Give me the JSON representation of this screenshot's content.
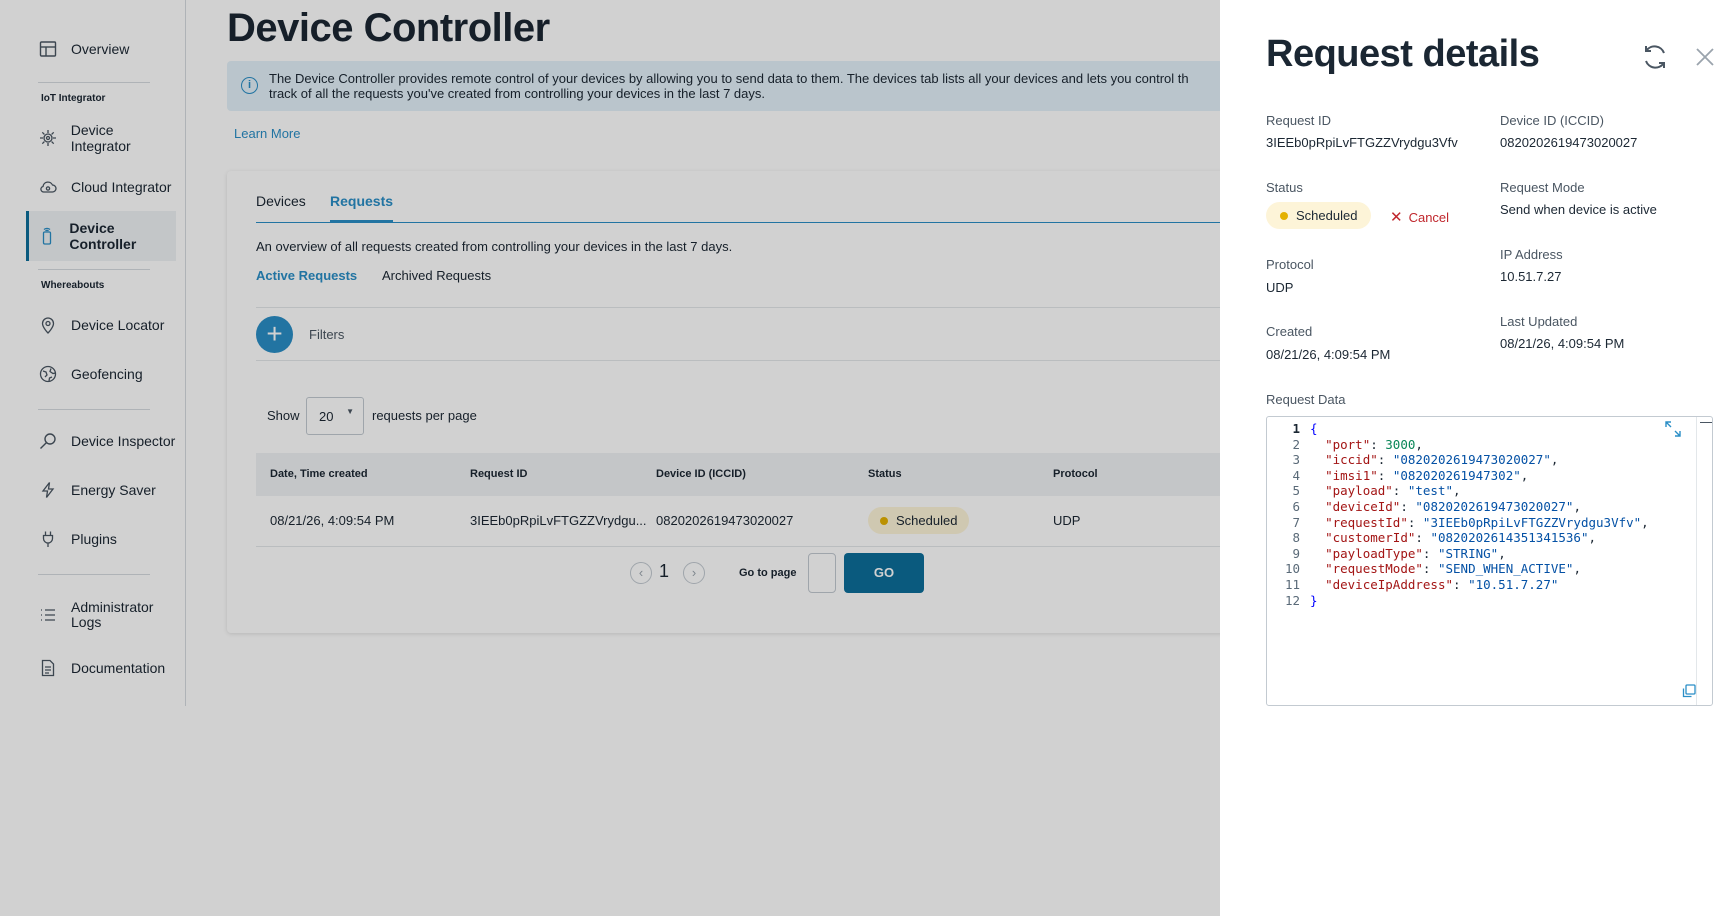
{
  "sidebar": {
    "items": [
      {
        "label": "Overview",
        "icon": "overview-icon"
      },
      {
        "label": "Device Integrator",
        "icon": "device-integrator-icon"
      },
      {
        "label": "Cloud Integrator",
        "icon": "cloud-integrator-icon"
      },
      {
        "label": "Device Controller",
        "icon": "device-controller-icon",
        "active": true
      },
      {
        "label": "Device Locator",
        "icon": "location-pin-icon"
      },
      {
        "label": "Geofencing",
        "icon": "geofencing-icon"
      },
      {
        "label": "Device Inspector",
        "icon": "inspector-icon"
      },
      {
        "label": "Energy Saver",
        "icon": "lightning-icon"
      },
      {
        "label": "Plugins",
        "icon": "plug-icon"
      },
      {
        "label": "Administrator Logs",
        "icon": "logs-icon"
      },
      {
        "label": "Documentation",
        "icon": "document-icon"
      }
    ],
    "sections": {
      "iot": "IoT Integrator",
      "whereabouts": "Whereabouts"
    }
  },
  "main": {
    "title": "Device Controller",
    "banner": "The Device Controller provides remote control of your devices by allowing you to send data to them. The devices tab lists all your devices and lets you control th track of all the requests you've created from controlling your devices in the last 7 days.",
    "banner_line1": "The Device Controller provides remote control of your devices by allowing you to send data to them. The devices tab lists all your devices and lets you control th",
    "banner_line2": "track of all the requests you've created from controlling your devices in the last 7 days.",
    "learn_more": "Learn More",
    "tabs": [
      {
        "label": "Devices"
      },
      {
        "label": "Requests",
        "active": true
      }
    ],
    "description": "An overview of all requests created from controlling your devices in the last 7 days.",
    "subtabs": [
      {
        "label": "Active Requests",
        "active": true
      },
      {
        "label": "Archived Requests"
      }
    ],
    "filters_label": "Filters",
    "show_label": "Show",
    "per_page_value": "20",
    "per_page_label": "requests per page",
    "table": {
      "columns": [
        "Date, Time created",
        "Request ID",
        "Device ID (ICCID)",
        "Status",
        "Protocol"
      ],
      "rows": [
        {
          "created": "08/21/26, 4:09:54 PM",
          "request_id": "3IEEb0pRpiLvFTGZZVrydgu...",
          "device_id": "0820202619473020027",
          "status": "Scheduled",
          "protocol": "UDP"
        }
      ]
    },
    "pagination": {
      "prev": "‹",
      "page": "1",
      "next": "›",
      "goto_label": "Go to page",
      "go_button": "GO"
    }
  },
  "drawer": {
    "title": "Request details",
    "fields": {
      "request_id_label": "Request ID",
      "request_id": "3IEEb0pRpiLvFTGZZVrydgu3Vfv",
      "device_id_label": "Device ID (ICCID)",
      "device_id": "0820202619473020027",
      "status_label": "Status",
      "status": "Scheduled",
      "cancel": "Cancel",
      "request_mode_label": "Request Mode",
      "request_mode": "Send when device is active",
      "ip_label": "IP Address",
      "ip": "10.51.7.27",
      "protocol_label": "Protocol",
      "protocol": "UDP",
      "created_label": "Created",
      "created": "08/21/26, 4:09:54 PM",
      "updated_label": "Last Updated",
      "updated": "08/21/26, 4:09:54 PM",
      "request_data_label": "Request Data"
    },
    "code_lines": [
      {
        "n": "1",
        "t": "{"
      },
      {
        "n": "2",
        "k": "port",
        "v": "3000",
        "type": "num",
        "comma": ","
      },
      {
        "n": "3",
        "k": "iccid",
        "v": "0820202619473020027",
        "type": "str",
        "comma": ","
      },
      {
        "n": "4",
        "k": "imsi1",
        "v": "082020261947302",
        "type": "str",
        "comma": ","
      },
      {
        "n": "5",
        "k": "payload",
        "v": "test",
        "type": "str",
        "comma": ","
      },
      {
        "n": "6",
        "k": "deviceId",
        "v": "0820202619473020027",
        "type": "str",
        "comma": ","
      },
      {
        "n": "7",
        "k": "requestId",
        "v": "3IEEb0pRpiLvFTGZZVrydgu3Vfv",
        "type": "str",
        "comma": ","
      },
      {
        "n": "8",
        "k": "customerId",
        "v": "0820202614351341536",
        "type": "str",
        "comma": ","
      },
      {
        "n": "9",
        "k": "payloadType",
        "v": "STRING",
        "type": "str",
        "comma": ","
      },
      {
        "n": "10",
        "k": "requestMode",
        "v": "SEND_WHEN_ACTIVE",
        "type": "str",
        "comma": ","
      },
      {
        "n": "11",
        "k": "deviceIpAddress",
        "v": "10.51.7.27",
        "type": "str",
        "comma": ""
      },
      {
        "n": "12",
        "t": "}"
      }
    ]
  },
  "colors": {
    "accent": "#2a8ec6",
    "primary_button": "#0d6e9a",
    "badge_bg": "#fdf4d8",
    "badge_dot": "#e4b100",
    "cancel": "#c0272d"
  }
}
